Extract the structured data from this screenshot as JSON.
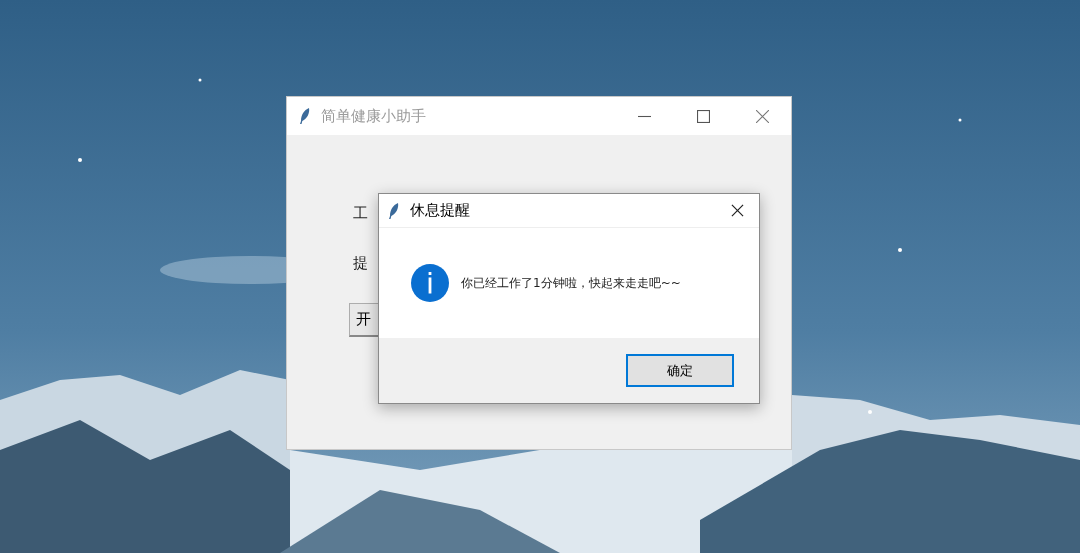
{
  "main_window": {
    "title": "简单健康小助手",
    "active": false,
    "labels": [
      "工",
      "提"
    ],
    "button": "开"
  },
  "dialog": {
    "title": "休息提醒",
    "message": "你已经工作了1分钟啦，快起来走走吧~~",
    "button": "确定",
    "button_focused": true
  }
}
